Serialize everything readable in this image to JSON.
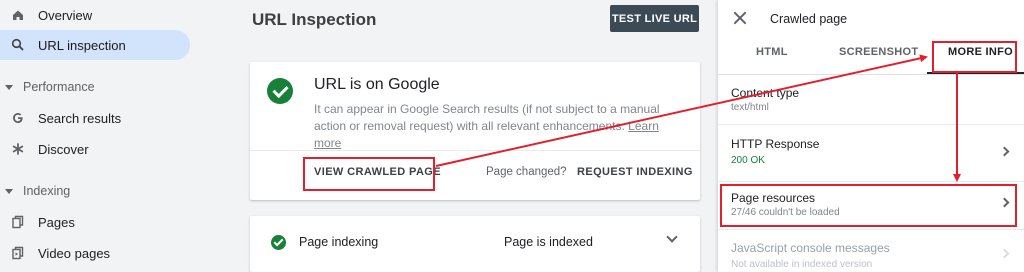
{
  "sidebar": {
    "items": [
      {
        "label": "Overview",
        "icon": "home-icon"
      },
      {
        "label": "URL inspection",
        "icon": "search-icon"
      }
    ],
    "sections": [
      {
        "label": "Performance",
        "items": [
          {
            "label": "Search results",
            "icon": "google-g-icon"
          },
          {
            "label": "Discover",
            "icon": "asterisk-icon"
          }
        ]
      },
      {
        "label": "Indexing",
        "items": [
          {
            "label": "Pages",
            "icon": "pages-icon"
          },
          {
            "label": "Video pages",
            "icon": "video-pages-icon"
          }
        ]
      }
    ]
  },
  "main": {
    "title": "URL Inspection",
    "test_live_label": "TEST LIVE URL",
    "status_card": {
      "title": "URL is on Google",
      "description": "It can appear in Google Search results (if not subject to a manual action or removal request) with all relevant enhancements.",
      "learn_more": "Learn more",
      "view_crawled_label": "VIEW CRAWLED PAGE",
      "page_changed": "Page changed?",
      "request_indexing_label": "REQUEST INDEXING"
    },
    "indexing_card": {
      "label": "Page indexing",
      "value": "Page is indexed"
    }
  },
  "panel": {
    "title": "Crawled page",
    "tabs": [
      "HTML",
      "SCREENSHOT",
      "MORE INFO"
    ],
    "rows": [
      {
        "label": "Content type",
        "sub": "text/html"
      },
      {
        "label": "HTTP Response",
        "sub": "200 OK"
      },
      {
        "label": "Page resources",
        "sub": "27/46 couldn't be loaded"
      },
      {
        "label": "JavaScript console messages",
        "sub": "Not available in indexed version"
      }
    ]
  },
  "colors": {
    "accent_active": "#d2e3fc",
    "success_green": "#188038",
    "button_dark": "#3c4a55",
    "annotation_red": "#e0202d"
  }
}
